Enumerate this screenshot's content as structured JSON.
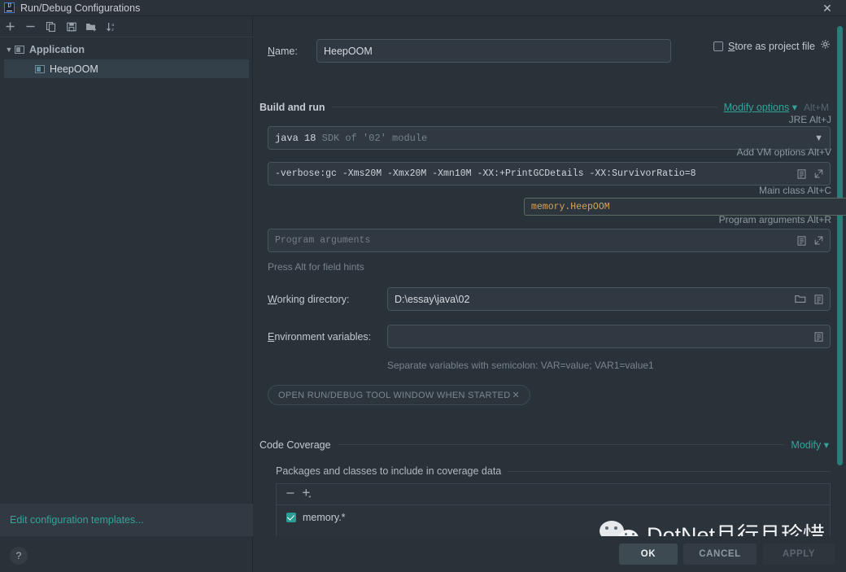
{
  "window": {
    "title": "Run/Debug Configurations",
    "app_icon": "intellij-idea-icon",
    "close_label": "✕"
  },
  "sidebar": {
    "toolbar": [
      {
        "name": "add-configuration-button",
        "glyph": "+"
      },
      {
        "name": "remove-configuration-button",
        "glyph": "−"
      },
      {
        "name": "copy-configuration-button",
        "glyph": "copy-icon"
      },
      {
        "name": "save-configuration-button",
        "glyph": "save-icon"
      },
      {
        "name": "move-into-folder-button",
        "glyph": "folder-add-icon"
      },
      {
        "name": "sort-configurations-button",
        "glyph": "sort-az-icon"
      }
    ],
    "tree": {
      "group_label": "Application",
      "items": [
        {
          "label": "HeepOOM",
          "selected": true
        }
      ]
    },
    "edit_templates_link": "Edit configuration templates...",
    "help_button": "?"
  },
  "form": {
    "name_label": "Name:",
    "name_value": "HeepOOM",
    "store_as_project_file_label": "Store as project file",
    "store_as_project_file_checked": false,
    "gear_icon": "gear-icon",
    "build_and_run": {
      "section_title": "Build and run",
      "modify_options_link": "Modify options",
      "modify_options_shortcut": "Alt+M",
      "jre_hint": "JRE Alt+J",
      "jre_value_primary": "java 18",
      "jre_value_secondary": "SDK of '02' module",
      "vm_options_hint": "Add VM options Alt+V",
      "vm_options_value": "-verbose:gc -Xms20M -Xmx20M -Xmn10M -XX:+PrintGCDetails -XX:SurvivorRatio=8",
      "main_class_hint": "Main class Alt+C",
      "main_class_value": "memory.HeepOOM",
      "program_arguments_hint": "Program arguments Alt+R",
      "program_arguments_placeholder": "Program arguments",
      "field_hint_note": "Press Alt for field hints"
    },
    "working_directory_label": "Working directory:",
    "working_directory_value": "D:\\essay\\java\\02",
    "environment_variables_label": "Environment variables:",
    "environment_variables_value": "",
    "environment_variables_note": "Separate variables with semicolon: VAR=value; VAR1=value1",
    "open_tool_window_chip": "OPEN RUN/DEBUG TOOL WINDOW WHEN STARTED",
    "open_tool_window_chip_close": "✕",
    "code_coverage": {
      "section_title": "Code Coverage",
      "modify_link": "Modify",
      "packages_label": "Packages and classes to include in coverage data",
      "list_toolbar": [
        {
          "name": "remove-package-button",
          "glyph": "−"
        },
        {
          "name": "add-package-button",
          "glyph": "+"
        }
      ],
      "rows": [
        {
          "label": "memory.*",
          "checked": true
        }
      ]
    }
  },
  "footer": {
    "ok_label": "OK",
    "cancel_label": "CANCEL",
    "apply_label": "APPLY"
  },
  "watermark": {
    "text": "DotNet且行且珍惜",
    "logo": "wechat-logo"
  },
  "colors": {
    "background": "#293139",
    "accent_teal": "#35a39b",
    "field_border": "#4a545d",
    "text_primary": "#d7dbdf",
    "text_muted": "#8e98a2",
    "code_orange": "#d6a35c",
    "scrollbar": "#2a7d78"
  }
}
